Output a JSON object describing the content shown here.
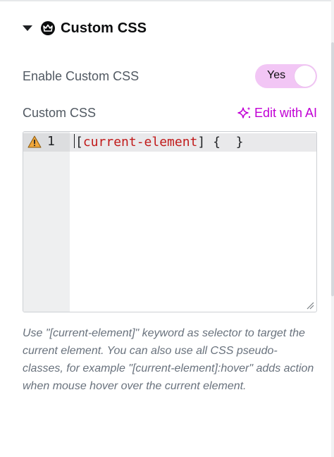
{
  "section": {
    "title": "Custom CSS",
    "expanded": true
  },
  "enable": {
    "label": "Enable Custom CSS",
    "toggle_label": "Yes",
    "checked": true
  },
  "css": {
    "label": "Custom CSS",
    "ai_link": "Edit with AI",
    "line_number": "1",
    "code_open": "[",
    "code_selector": "current-element",
    "code_rest": "] {  }",
    "warning": true
  },
  "help_text": "Use \"[current-element]\" keyword as selector to target the current element. You can also use all CSS pseudo-classes, for example \"[current-element]:hover\" adds action when mouse hover over the current element.",
  "colors": {
    "accent": "#c100d5",
    "toggle_bg": "#f2c6f5",
    "selector": "#c11a1a",
    "warning": "#f0a63a"
  }
}
